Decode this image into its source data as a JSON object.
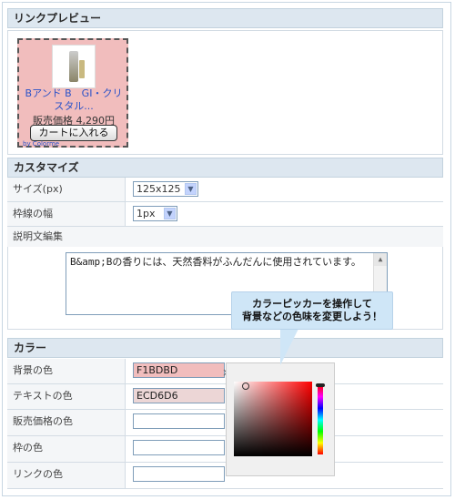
{
  "preview": {
    "section_title": "リンクプレビュー",
    "product_title": "Bアンド B　GI・クリスタル...",
    "price": "販売価格 4,290円",
    "cart_button": "カートに入れる",
    "tiny_link": "by Colorme",
    "bg_color": "#F1BDBD"
  },
  "customize": {
    "section_title": "カスタマイズ",
    "size_label": "サイズ(px)",
    "size_value": "125x125",
    "border_label": "枠線の幅",
    "border_value": "1px",
    "desc_label": "説明文編集",
    "desc_text": "B&amp;Bの香りには、天然香料がふんだんに使用されています。"
  },
  "tooltip": {
    "line1": "カラーピッカーを操作して",
    "line2": "背景などの色味を変更しよう！"
  },
  "colors": {
    "section_title": "カラー",
    "bg_label": "背景の色",
    "bg_value": "F1BDBD",
    "text_label": "テキストの色",
    "text_value": "ECD6D6",
    "price_label": "販売価格の色",
    "price_value": "",
    "border_label": "枠の色",
    "border_value": "",
    "link_label": "リンクの色",
    "link_value": ""
  },
  "picker": {
    "close": "×"
  }
}
